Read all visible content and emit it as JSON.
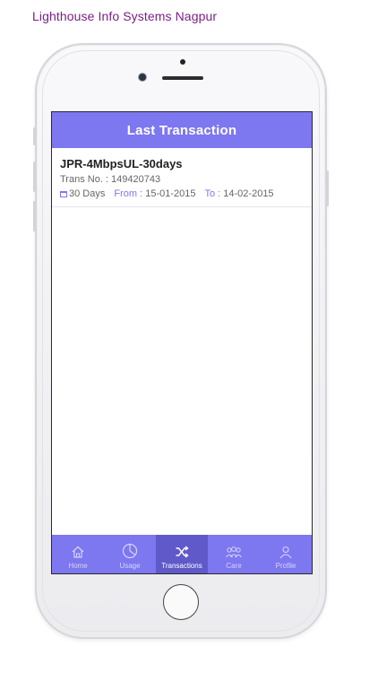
{
  "caption": "Lighthouse Info Systems Nagpur",
  "header": {
    "title": "Last Transaction"
  },
  "transaction": {
    "plan": "JPR-4MbpsUL-30days",
    "trans_no": "Trans No. : 149420743",
    "duration": "30 Days",
    "from_label": "From :",
    "from_date": "15-01-2015",
    "to_label": "To :",
    "to_date": "14-02-2015"
  },
  "tabs": [
    {
      "label": "Home",
      "icon": "home-icon",
      "active": false
    },
    {
      "label": "Usage",
      "icon": "pie-chart-icon",
      "active": false
    },
    {
      "label": "Transactions",
      "icon": "shuffle-icon",
      "active": true
    },
    {
      "label": "Care",
      "icon": "people-icon",
      "active": false
    },
    {
      "label": "Profile",
      "icon": "user-icon",
      "active": false
    }
  ],
  "colors": {
    "accent": "#7d77f0",
    "tab_active": "#5f59c9",
    "caption": "#7a1f86"
  }
}
